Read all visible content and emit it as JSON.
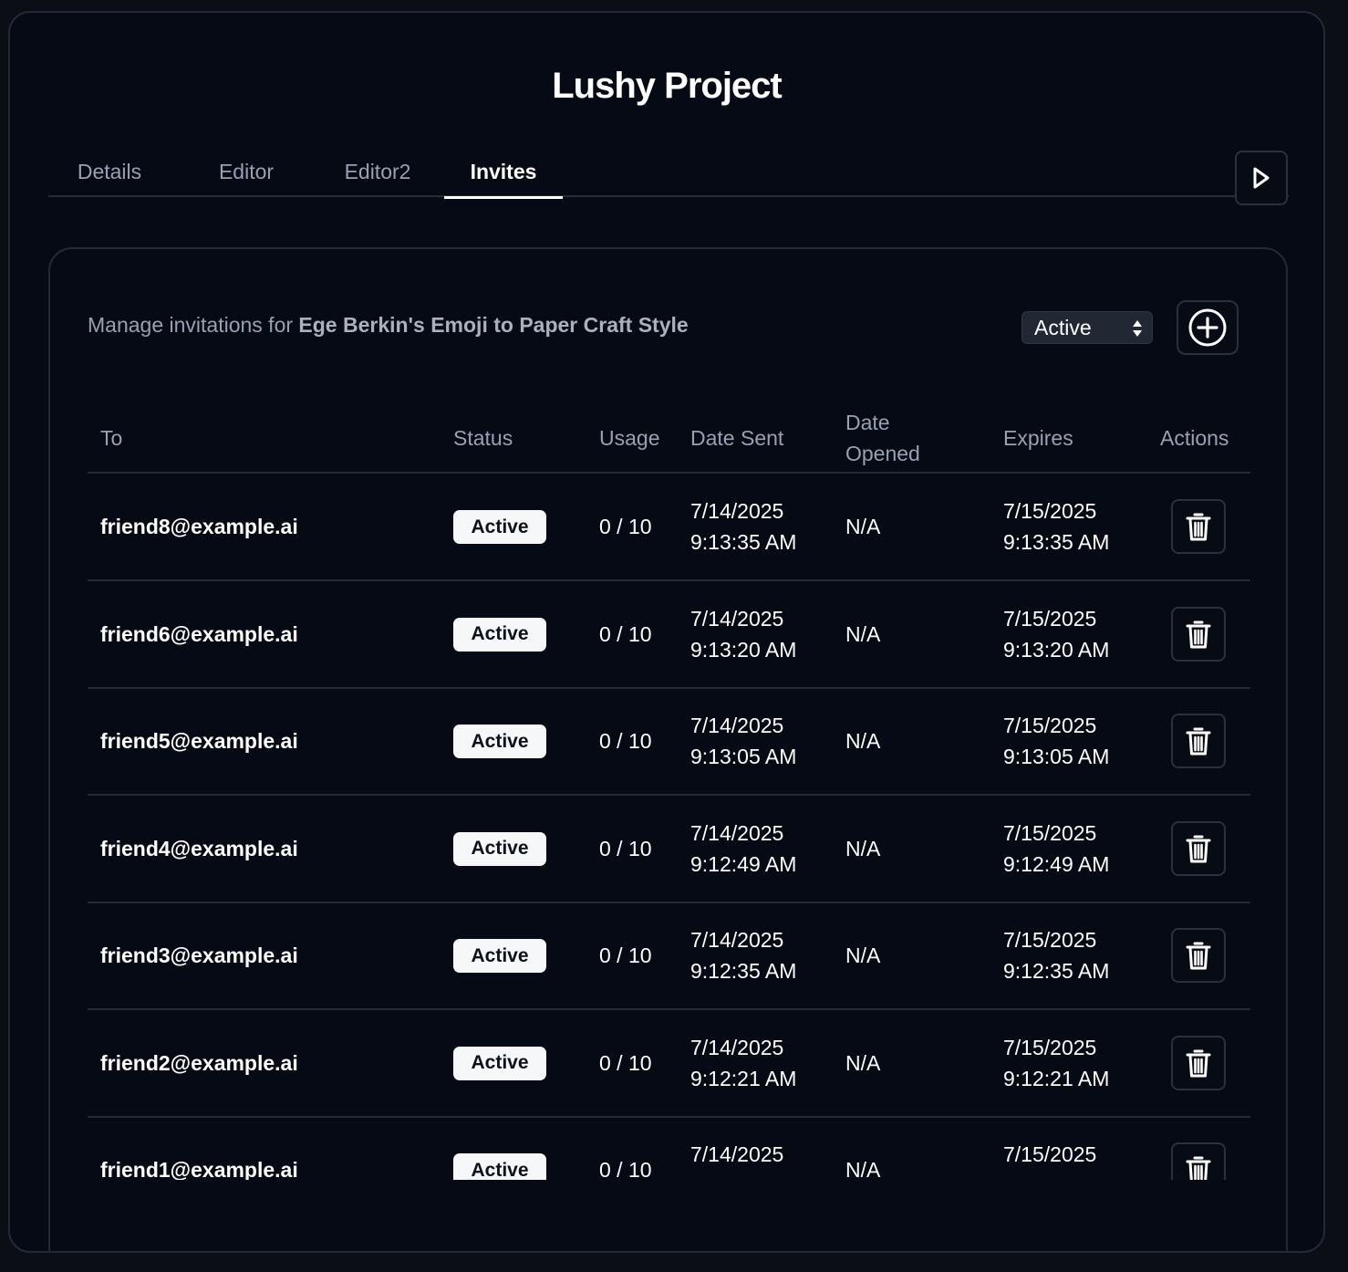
{
  "project": {
    "title": "Lushy Project"
  },
  "tabs": [
    {
      "label": "Details"
    },
    {
      "label": "Editor"
    },
    {
      "label": "Editor2"
    },
    {
      "label": "Invites",
      "active": true
    }
  ],
  "icons": {
    "play": "play-icon",
    "add": "plus-circle-icon",
    "delete": "trash-icon",
    "select_arrows": "sort-arrows-icon"
  },
  "invites": {
    "manage_prefix": "Manage invitations for ",
    "manage_target": "Ege Berkin's Emoji to Paper Craft Style",
    "filter": {
      "selected": "Active"
    },
    "columns": {
      "to": "To",
      "status": "Status",
      "usage": "Usage",
      "date_sent": "Date Sent",
      "date_opened_line1": "Date",
      "date_opened_line2": "Opened",
      "expires": "Expires",
      "actions": "Actions"
    },
    "rows": [
      {
        "to": "friend8@example.ai",
        "status": "Active",
        "usage": "0 / 10",
        "sent_date": "7/14/2025",
        "sent_time": "9:13:35 AM",
        "opened": "N/A",
        "expires_date": "7/15/2025",
        "expires_time": "9:13:35 AM"
      },
      {
        "to": "friend6@example.ai",
        "status": "Active",
        "usage": "0 / 10",
        "sent_date": "7/14/2025",
        "sent_time": "9:13:20 AM",
        "opened": "N/A",
        "expires_date": "7/15/2025",
        "expires_time": "9:13:20 AM"
      },
      {
        "to": "friend5@example.ai",
        "status": "Active",
        "usage": "0 / 10",
        "sent_date": "7/14/2025",
        "sent_time": "9:13:05 AM",
        "opened": "N/A",
        "expires_date": "7/15/2025",
        "expires_time": "9:13:05 AM"
      },
      {
        "to": "friend4@example.ai",
        "status": "Active",
        "usage": "0 / 10",
        "sent_date": "7/14/2025",
        "sent_time": "9:12:49 AM",
        "opened": "N/A",
        "expires_date": "7/15/2025",
        "expires_time": "9:12:49 AM"
      },
      {
        "to": "friend3@example.ai",
        "status": "Active",
        "usage": "0 / 10",
        "sent_date": "7/14/2025",
        "sent_time": "9:12:35 AM",
        "opened": "N/A",
        "expires_date": "7/15/2025",
        "expires_time": "9:12:35 AM"
      },
      {
        "to": "friend2@example.ai",
        "status": "Active",
        "usage": "0 / 10",
        "sent_date": "7/14/2025",
        "sent_time": "9:12:21 AM",
        "opened": "N/A",
        "expires_date": "7/15/2025",
        "expires_time": "9:12:21 AM"
      },
      {
        "to": "friend1@example.ai",
        "status": "Active",
        "usage": "0 / 10",
        "sent_date": "7/14/2025",
        "sent_time": "",
        "opened": "N/A",
        "expires_date": "7/15/2025",
        "expires_time": ""
      }
    ]
  }
}
